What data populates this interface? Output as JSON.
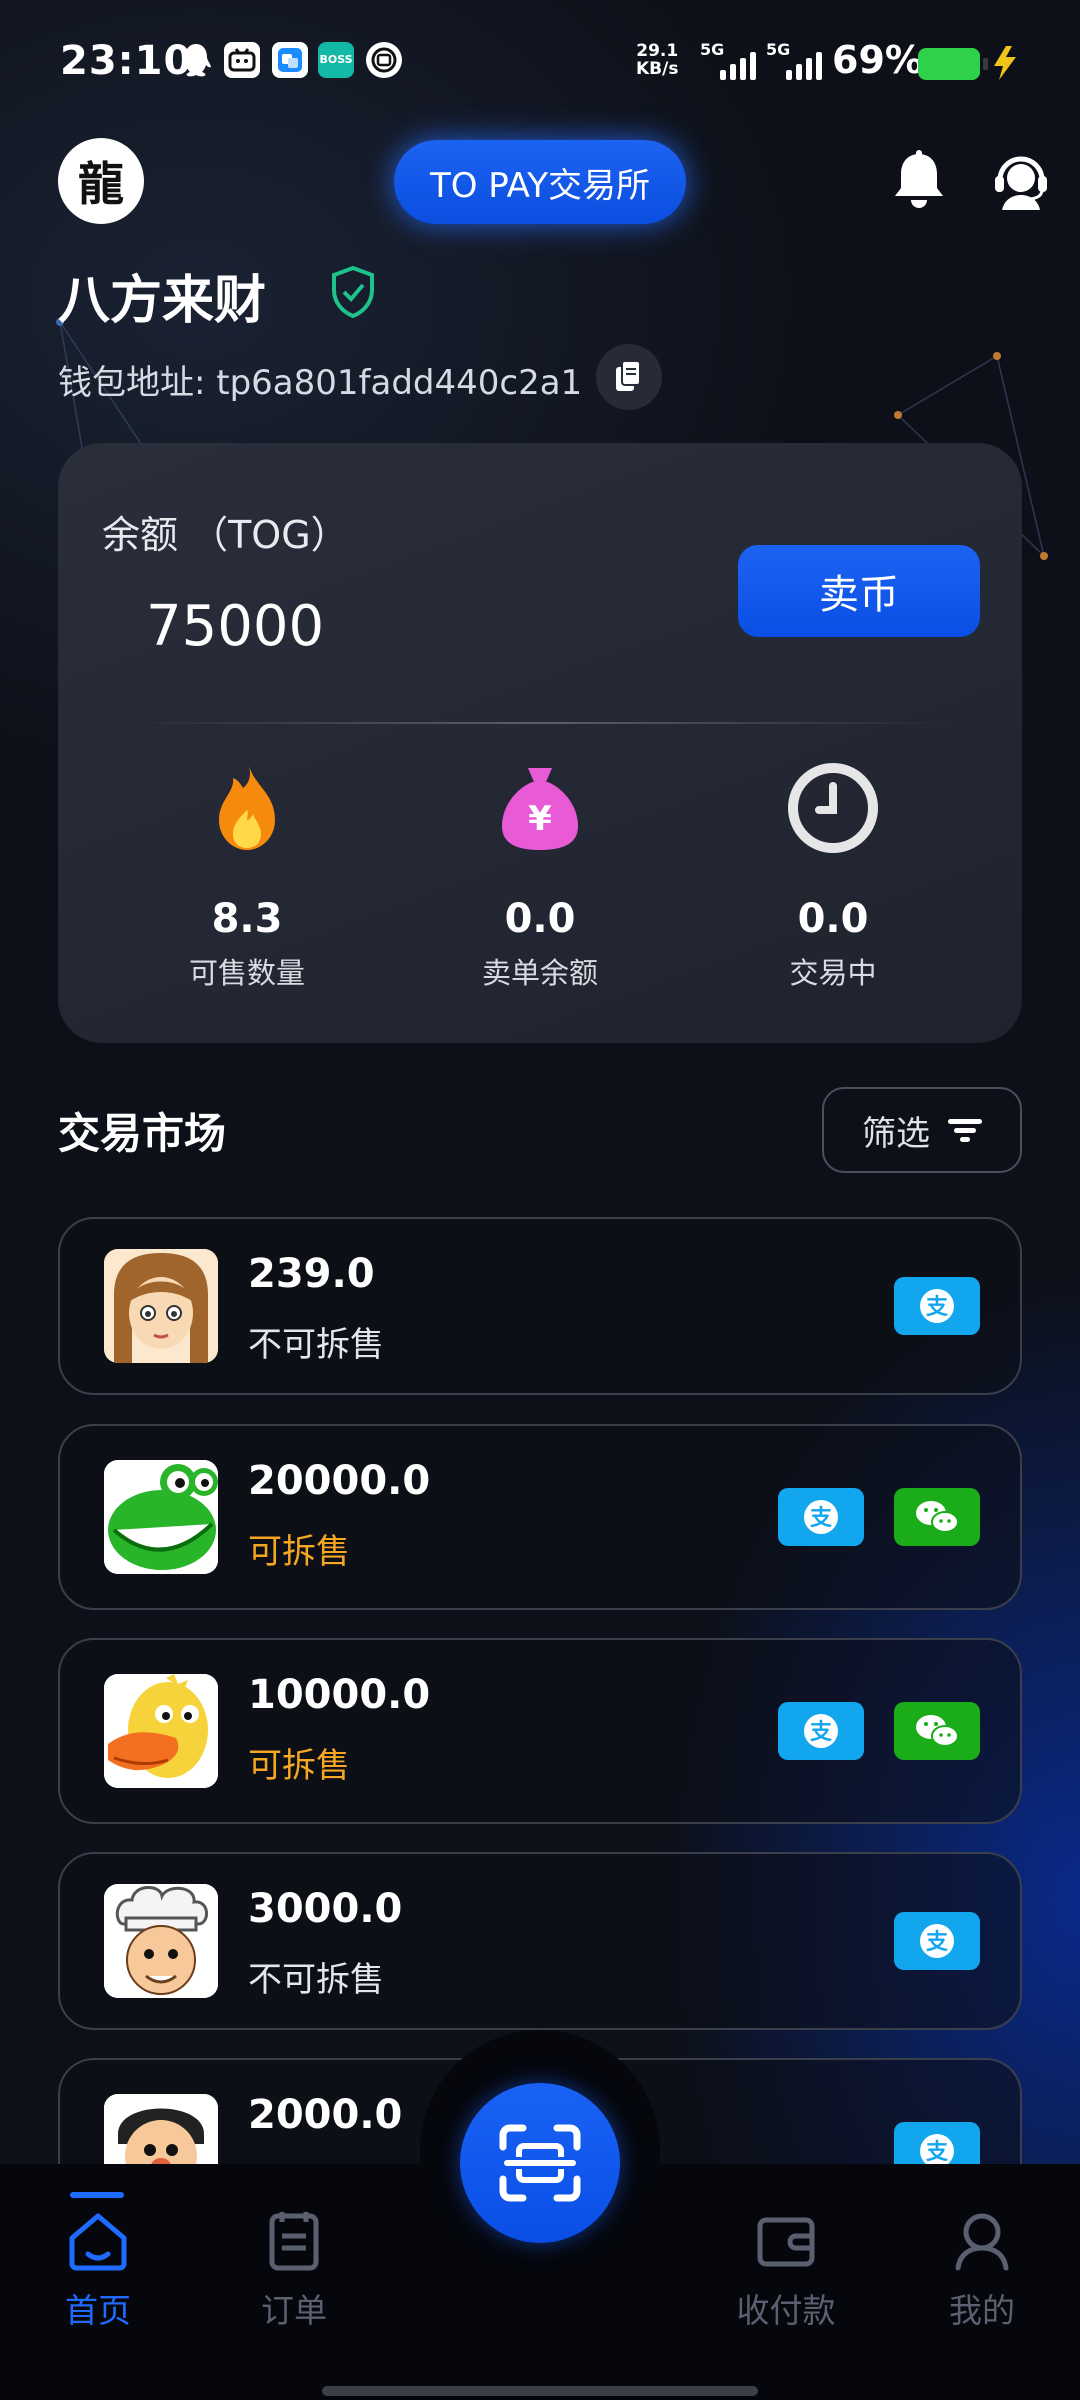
{
  "status_bar": {
    "time": "23:10",
    "net_speed_value": "29.1",
    "net_speed_unit": "KB/s",
    "signal1_label": "5G",
    "signal2_label": "5G",
    "battery_percent": "69%",
    "notification_icons": [
      "qq-icon",
      "bilibili-icon",
      "app-icon",
      "boss-zhipin-icon",
      "lens-icon"
    ],
    "boss_label": "BOSS"
  },
  "header": {
    "logo_char": "龍",
    "exchange_name": "TO PAY交易所"
  },
  "user": {
    "name": "八方来财",
    "wallet_label": "钱包地址: tp6a801fadd440c2a1"
  },
  "balance_card": {
    "label": "余额 （TOG）",
    "value": "75000",
    "sell_label": "卖币",
    "stats": [
      {
        "value": "8.3",
        "label": "可售数量",
        "icon": "fire-icon"
      },
      {
        "value": "0.0",
        "label": "卖单余额",
        "icon": "money-bag-icon"
      },
      {
        "value": "0.0",
        "label": "交易中",
        "icon": "clock-icon"
      }
    ]
  },
  "market": {
    "title": "交易市场",
    "filter_label": "筛选",
    "listings": [
      {
        "amount": "239.0",
        "split": "不可拆售",
        "splittable": false,
        "payments": [
          "alipay"
        ],
        "avatar": "girl"
      },
      {
        "amount": "20000.0",
        "split": "可拆售",
        "splittable": true,
        "payments": [
          "alipay",
          "wechat"
        ],
        "avatar": "frog"
      },
      {
        "amount": "10000.0",
        "split": "可拆售",
        "splittable": true,
        "payments": [
          "alipay",
          "wechat"
        ],
        "avatar": "duck"
      },
      {
        "amount": "3000.0",
        "split": "不可拆售",
        "splittable": false,
        "payments": [
          "alipay"
        ],
        "avatar": "chef"
      },
      {
        "amount": "2000.0",
        "split": "",
        "splittable": false,
        "payments": [
          "alipay"
        ],
        "avatar": "man"
      }
    ]
  },
  "bottom_nav": {
    "items": [
      {
        "label": "首页",
        "icon": "home-icon",
        "active": true
      },
      {
        "label": "订单",
        "icon": "orders-icon",
        "active": false
      },
      {
        "label": "收付款",
        "icon": "wallet-icon",
        "active": false
      },
      {
        "label": "我的",
        "icon": "profile-icon",
        "active": false
      }
    ]
  },
  "colors": {
    "accent": "#1f6bff",
    "splittable": "#f5a623",
    "alipay": "#12a6ee",
    "wechat": "#1aad19"
  }
}
